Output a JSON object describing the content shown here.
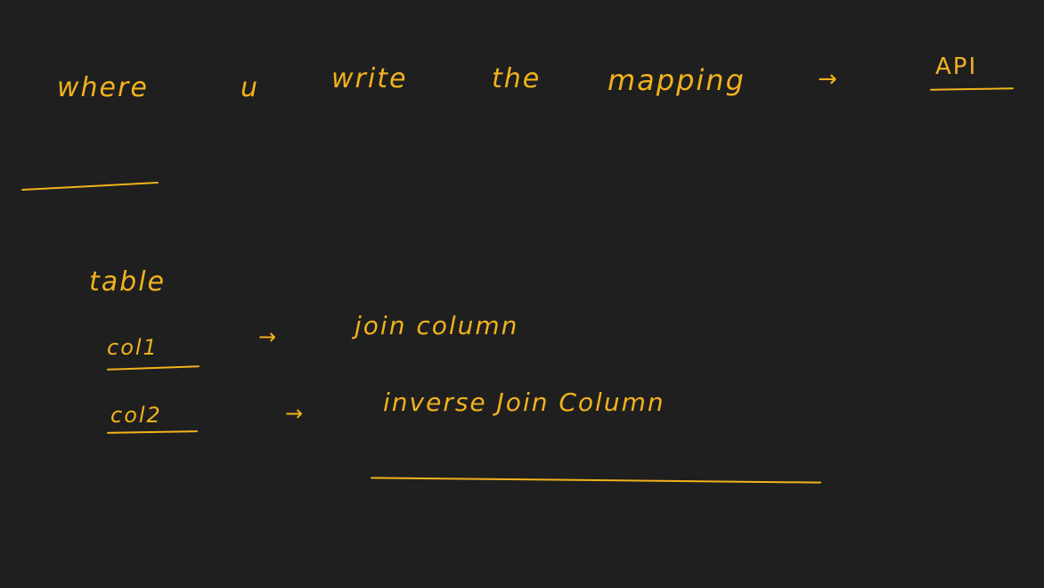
{
  "canvas": {
    "background": "#1f1f1f",
    "ink_color": "#f2b21c"
  },
  "note": {
    "line1": {
      "word_where": "where",
      "word_u": "u",
      "word_write": "write",
      "word_the": "the",
      "word_mapping": "mapping",
      "arrow": "→",
      "word_api": "API"
    },
    "section_label": "table",
    "rows": [
      {
        "key": "col1",
        "arrow": "→",
        "value": "join column"
      },
      {
        "key": "col2",
        "arrow": "→",
        "value": "inverse Join Column"
      }
    ]
  }
}
